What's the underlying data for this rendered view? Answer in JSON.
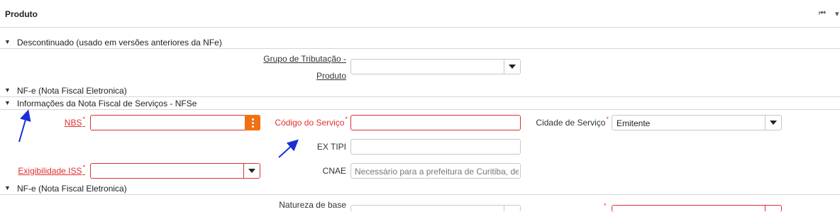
{
  "header": {
    "title": "Produto",
    "first_icon": "⏮",
    "menu_icon": "▾"
  },
  "sections": {
    "descontinuado": "Descontinuado (usado em versões anteriores da NFe)",
    "nfe1": "NF-e (Nota Fiscal Eletronica)",
    "nfse": "Informações da Nota Fiscal de Serviços - NFSe",
    "nfe2": "NF-e (Nota Fiscal Eletronica)"
  },
  "fields": {
    "grupo_tributacao": {
      "label_line1": "Grupo de Tributação -",
      "label_line2": "Produto",
      "value": ""
    },
    "nbs": {
      "label": "NBS",
      "required_mark": "*",
      "value": ""
    },
    "codigo_servico": {
      "label": "Código do Serviço",
      "required_mark": "*",
      "value": ""
    },
    "cidade_servico": {
      "label": "Cidade de Serviço",
      "required_mark": "*",
      "value": "Emitente"
    },
    "ex_tipi": {
      "label": "EX TIPI",
      "value": ""
    },
    "exigibilidade_iss": {
      "label": "Exigibilidade ISS",
      "required_mark": "*",
      "value": ""
    },
    "cnae": {
      "label": "CNAE",
      "placeholder": "Necessário para a prefeitura de Curitiba, de R"
    },
    "natureza_base": {
      "label": "Natureza de base"
    },
    "partial_right": {
      "required_mark": "*"
    }
  },
  "colors": {
    "required": "#e03030",
    "kebab": "#f07014",
    "annotation_arrow": "#1a2fd6"
  }
}
